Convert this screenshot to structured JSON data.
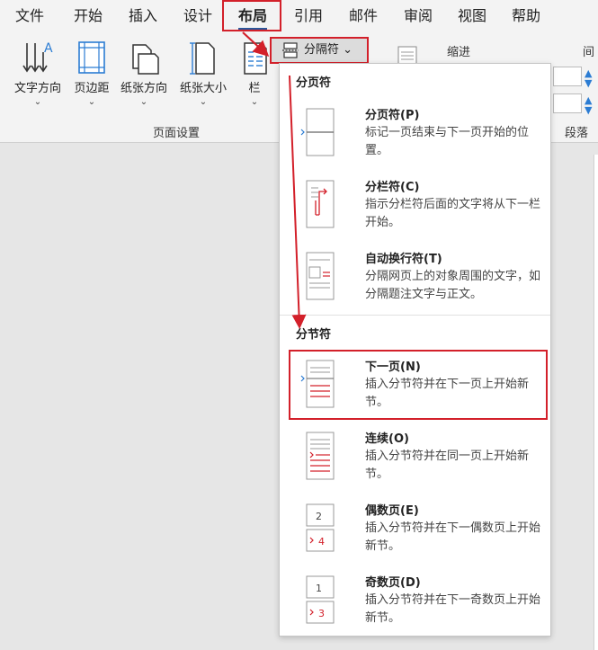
{
  "tabs": [
    {
      "label": "文件"
    },
    {
      "label": "开始"
    },
    {
      "label": "插入"
    },
    {
      "label": "设计"
    },
    {
      "label": "布局"
    },
    {
      "label": "引用"
    },
    {
      "label": "邮件"
    },
    {
      "label": "审阅"
    },
    {
      "label": "视图"
    },
    {
      "label": "帮助"
    }
  ],
  "ribbon": {
    "buttons": [
      {
        "label": "文字方向",
        "icon": "text-direction-icon"
      },
      {
        "label": "页边距",
        "icon": "margins-icon"
      },
      {
        "label": "纸张方向",
        "icon": "orientation-icon"
      },
      {
        "label": "纸张大小",
        "icon": "paper-size-icon"
      },
      {
        "label": "栏",
        "icon": "columns-icon"
      }
    ],
    "breaks_button": "分隔符",
    "group_page_setup": "页面设置",
    "indent_label": "缩进",
    "spacing_label": "间",
    "group_paragraph": "段落"
  },
  "dropdown": {
    "page_breaks_heading": "分页符",
    "section_breaks_heading": "分节符",
    "page_items": [
      {
        "title": "分页符(P)",
        "desc": "标记一页结束与下一页开始的位置。",
        "icon": "page-break-icon"
      },
      {
        "title": "分栏符(C)",
        "desc": "指示分栏符后面的文字将从下一栏开始。",
        "icon": "column-break-icon"
      },
      {
        "title": "自动换行符(T)",
        "desc": "分隔网页上的对象周围的文字，如分隔题注文字与正文。",
        "icon": "text-wrapping-icon"
      }
    ],
    "section_items": [
      {
        "title": "下一页(N)",
        "desc": "插入分节符并在下一页上开始新节。",
        "icon": "next-page-icon"
      },
      {
        "title": "连续(O)",
        "desc": "插入分节符并在同一页上开始新节。",
        "icon": "continuous-icon"
      },
      {
        "title": "偶数页(E)",
        "desc": "插入分节符并在下一偶数页上开始新节。",
        "icon": "even-page-icon"
      },
      {
        "title": "奇数页(D)",
        "desc": "插入分节符并在下一奇数页上开始新节。",
        "icon": "odd-page-icon"
      }
    ]
  },
  "colors": {
    "highlight": "#d3202a",
    "accent": "#2b579a"
  }
}
